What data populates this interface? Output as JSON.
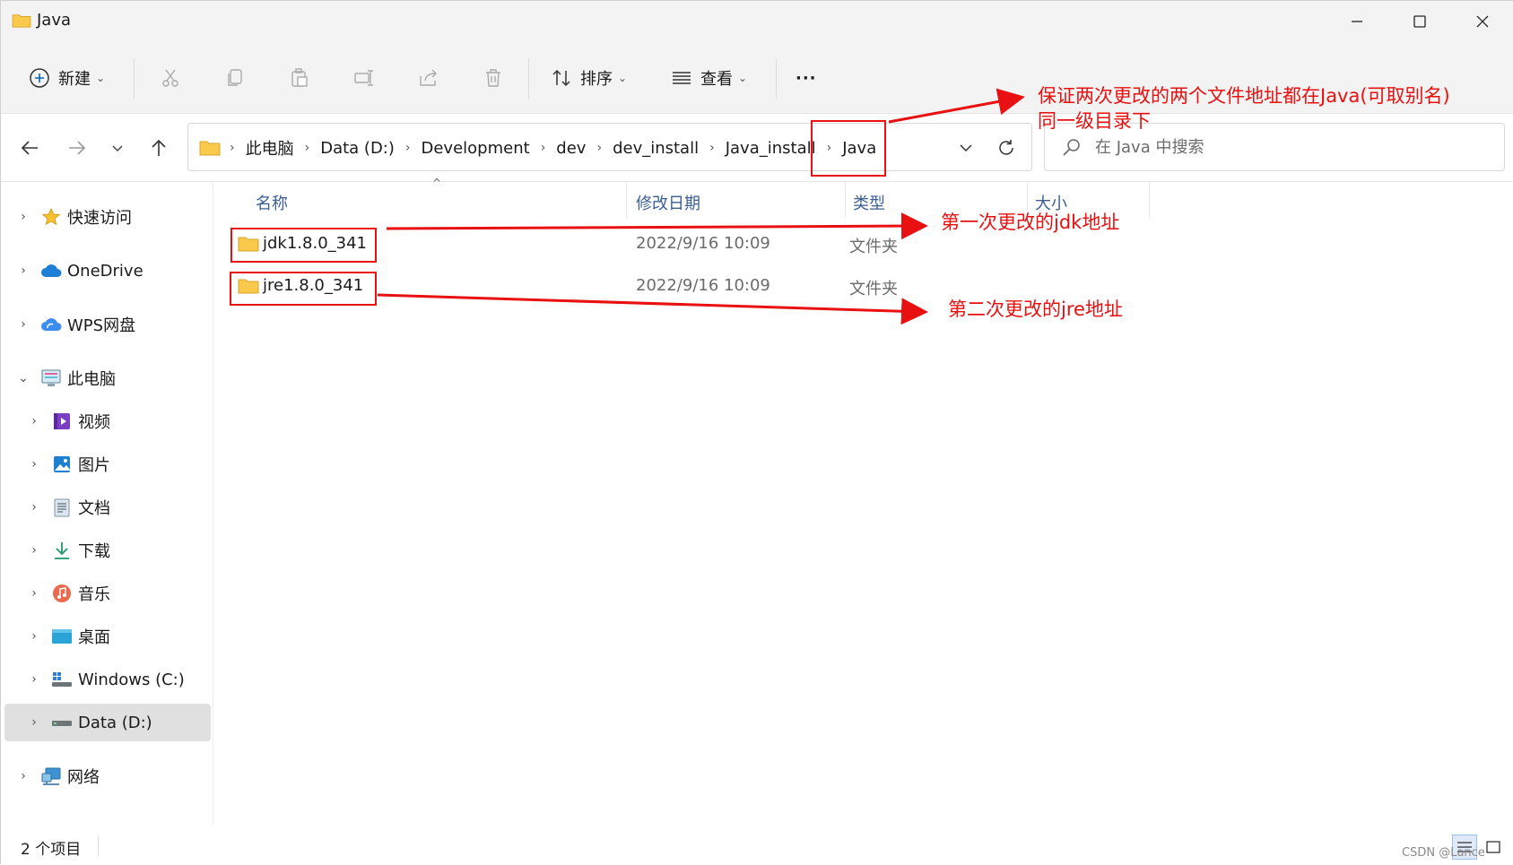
{
  "window": {
    "title": "Java",
    "minimize_icon": "minimize-icon",
    "maximize_icon": "maximize-icon",
    "close_icon": "close-icon"
  },
  "toolbar": {
    "new_label": "新建",
    "sort_label": "排序",
    "view_label": "查看",
    "more_label": "···",
    "icons": [
      "plus-circle-icon",
      "cut-icon",
      "copy-icon",
      "paste-icon",
      "rename-icon",
      "share-icon",
      "delete-icon",
      "sort-icon",
      "view-list-icon"
    ]
  },
  "navigation": {
    "back_icon": "arrow-left-icon",
    "forward_icon": "arrow-right-icon",
    "recent_icon": "chevron-down-icon",
    "up_icon": "arrow-up-icon"
  },
  "address": {
    "crumbs": [
      "此电脑",
      "Data (D:)",
      "Development",
      "dev",
      "dev_install",
      "Java_install",
      "Java"
    ],
    "refresh_icon": "refresh-icon"
  },
  "search": {
    "placeholder": "在 Java 中搜索"
  },
  "sidebar": {
    "items": [
      {
        "label": "快速访问",
        "icon": "star-icon",
        "expanded": false
      },
      {
        "label": "OneDrive",
        "icon": "cloud-icon",
        "expanded": false
      },
      {
        "label": "WPS网盘",
        "icon": "wps-cloud-icon",
        "expanded": false
      },
      {
        "label": "此电脑",
        "icon": "computer-icon",
        "expanded": true
      },
      {
        "label": "视频",
        "icon": "video-icon",
        "expanded": false
      },
      {
        "label": "图片",
        "icon": "pictures-icon",
        "expanded": false
      },
      {
        "label": "文档",
        "icon": "documents-icon",
        "expanded": false
      },
      {
        "label": "下载",
        "icon": "download-icon",
        "expanded": false
      },
      {
        "label": "音乐",
        "icon": "music-icon",
        "expanded": false
      },
      {
        "label": "桌面",
        "icon": "desktop-icon",
        "expanded": false
      },
      {
        "label": "Windows (C:)",
        "icon": "windows-drive-icon",
        "expanded": false
      },
      {
        "label": "Data (D:)",
        "icon": "drive-icon",
        "expanded": false,
        "selected": true
      },
      {
        "label": "网络",
        "icon": "network-icon",
        "expanded": false
      }
    ]
  },
  "file_list": {
    "columns": [
      "名称",
      "修改日期",
      "类型",
      "大小"
    ],
    "rows": [
      {
        "name": "jdk1.8.0_341",
        "date": "2022/9/16 10:09",
        "type": "文件夹",
        "size": ""
      },
      {
        "name": "jre1.8.0_341",
        "date": "2022/9/16 10:09",
        "type": "文件夹",
        "size": ""
      }
    ]
  },
  "status": {
    "item_count": "2 个项目",
    "watermark": "CSDN @Lance"
  },
  "annotations": {
    "note_path_line1": "保证两次更改的两个文件地址都在Java(可取别名)",
    "note_path_line2": "同一级目录下",
    "note_jdk": "第一次更改的jdk地址",
    "note_jre": "第二次更改的jre地址",
    "color": "#e81010"
  },
  "colors": {
    "accent": "#0067c0",
    "folder": "#f8c94a",
    "selected_bg": "#e0e0e0",
    "header_text": "#3b5f93"
  }
}
